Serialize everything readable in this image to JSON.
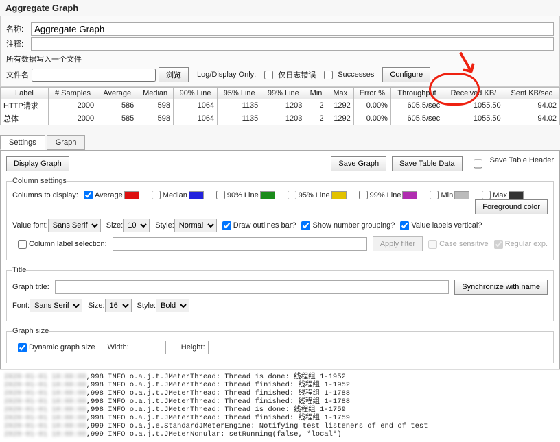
{
  "title": "Aggregate Graph",
  "fields": {
    "name_lbl": "名称:",
    "name_val": "Aggregate Graph",
    "comment_lbl": "注释:",
    "comment_val": "",
    "file_sec_lbl": "所有数据写入一个文件",
    "file_lbl": "文件名",
    "file_val": "",
    "browse": "浏览",
    "logdisplay": "Log/Display Only:",
    "errors_only": "仅日志错误",
    "successes": "Successes",
    "configure": "Configure"
  },
  "headers": [
    "Label",
    "# Samples",
    "Average",
    "Median",
    "90% Line",
    "95% Line",
    "99% Line",
    "Min",
    "Max",
    "Error %",
    "Throughput",
    "Received KB/",
    "Sent KB/sec"
  ],
  "rows": [
    [
      "HTTP请求",
      "2000",
      "586",
      "598",
      "1064",
      "1135",
      "1203",
      "2",
      "1292",
      "0.00%",
      "605.5/sec",
      "1055.50",
      "94.02"
    ],
    [
      "总体",
      "2000",
      "585",
      "598",
      "1064",
      "1135",
      "1203",
      "2",
      "1292",
      "0.00%",
      "605.5/sec",
      "1055.50",
      "94.02"
    ]
  ],
  "tabs": {
    "settings": "Settings",
    "graph": "Graph"
  },
  "buttons": {
    "display_graph": "Display Graph",
    "save_graph": "Save Graph",
    "save_table": "Save Table Data",
    "save_header": "Save Table Header"
  },
  "cols": {
    "legend": "Column settings",
    "to_display": "Columns to display:",
    "avg": "Average",
    "med": "Median",
    "p90": "90% Line",
    "p95": "95% Line",
    "p99": "99% Line",
    "min": "Min",
    "max": "Max",
    "fg": "Foreground color",
    "vfont": "Value font:",
    "size": "Size:",
    "style": "Style:",
    "font_family": "Sans Serif",
    "font_size": "10",
    "font_style": "Normal",
    "outlines": "Draw outlines bar?",
    "grouping": "Show number grouping?",
    "vertical": "Value labels vertical?",
    "col_sel": "Column label selection:",
    "apply": "Apply filter",
    "case": "Case sensitive",
    "regex": "Regular exp."
  },
  "swatches": {
    "avg": "#d11",
    "med": "#22d",
    "p90": "#1a8b1a",
    "p95": "#e2c200",
    "p99": "#b02db0",
    "min": "#bbb",
    "max": "#333"
  },
  "titleSec": {
    "legend": "Title",
    "graph_title": "Graph title:",
    "val": "",
    "sync": "Synchronize with name",
    "font": "Font:",
    "size": "Size:",
    "style": "Style:",
    "font_family": "Sans Serif",
    "font_size": "16",
    "font_style": "Bold"
  },
  "gsize": {
    "legend": "Graph size",
    "dyn": "Dynamic graph size",
    "width": "Width:",
    "height": "Height:"
  },
  "log_lines": [
    ",998 INFO o.a.j.t.JMeterThread: Thread is done: 线程组 1-1952",
    ",998 INFO o.a.j.t.JMeterThread: Thread finished: 线程组 1-1952",
    ",998 INFO o.a.j.t.JMeterThread: Thread finished: 线程组 1-1788",
    ",998 INFO o.a.j.t.JMeterThread: Thread finished: 线程组 1-1788",
    ",998 INFO o.a.j.t.JMeterThread: Thread is done: 线程组 1-1759",
    ",998 INFO o.a.j.t.JMeterThread: Thread finished: 线程组 1-1759",
    ",999 INFO o.a.j.e.StandardJMeterEngine: Notifying test listeners of end of test",
    ",999 INFO o.a.j.t.JMeterNonular: setRunning(false, *local*)"
  ],
  "chart_data": {
    "type": "table",
    "columns": [
      "Label",
      "# Samples",
      "Average",
      "Median",
      "90% Line",
      "95% Line",
      "99% Line",
      "Min",
      "Max",
      "Error %",
      "Throughput",
      "Received KB/sec",
      "Sent KB/sec"
    ],
    "rows": [
      {
        "Label": "HTTP请求",
        "# Samples": 2000,
        "Average": 586,
        "Median": 598,
        "90% Line": 1064,
        "95% Line": 1135,
        "99% Line": 1203,
        "Min": 2,
        "Max": 1292,
        "Error %": 0.0,
        "Throughput": "605.5/sec",
        "Received KB/sec": 1055.5,
        "Sent KB/sec": 94.02
      },
      {
        "Label": "总体",
        "# Samples": 2000,
        "Average": 585,
        "Median": 598,
        "90% Line": 1064,
        "95% Line": 1135,
        "99% Line": 1203,
        "Min": 2,
        "Max": 1292,
        "Error %": 0.0,
        "Throughput": "605.5/sec",
        "Received KB/sec": 1055.5,
        "Sent KB/sec": 94.02
      }
    ],
    "highlighted_column": "Throughput"
  }
}
